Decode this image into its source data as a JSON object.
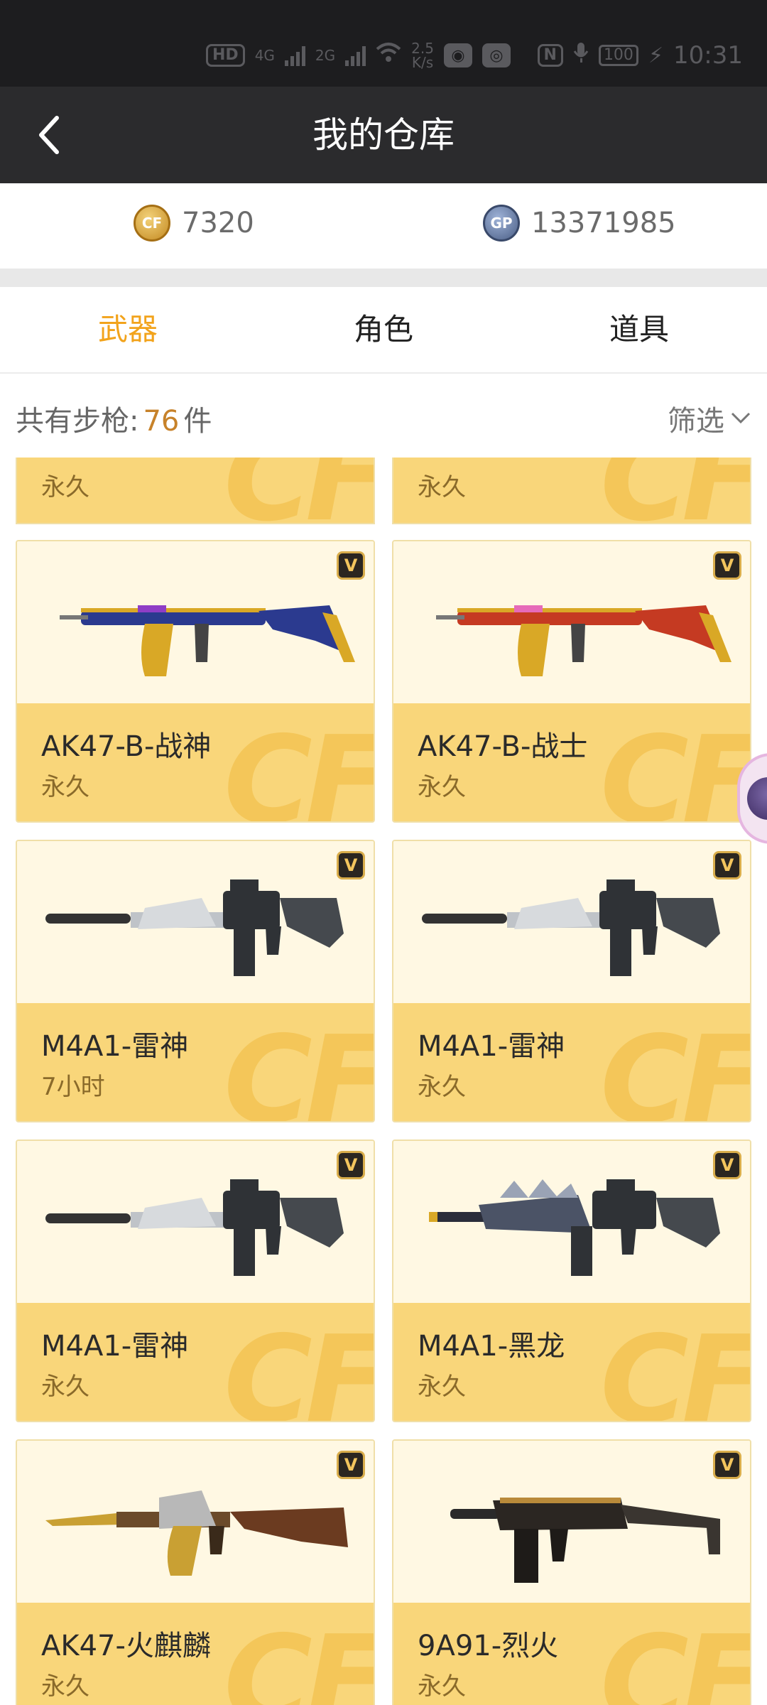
{
  "status_bar": {
    "hd_label": "HD",
    "net1": "4G",
    "net2": "2G",
    "speed_value": "2.5",
    "speed_unit": "K/s",
    "battery": "100",
    "time": "10:31"
  },
  "header": {
    "title": "我的仓库"
  },
  "currency": {
    "cf_coin_icon": "cf-coin-icon",
    "cf_amount": "7320",
    "gp_coin_icon": "gp-coin-icon",
    "gp_label": "GP",
    "gp_amount": "13371985"
  },
  "tabs": [
    {
      "label": "武器",
      "active": true
    },
    {
      "label": "角色",
      "active": false
    },
    {
      "label": "道具",
      "active": false
    }
  ],
  "inventory": {
    "prefix": "共有步枪:",
    "count": "76",
    "suffix": "件",
    "filter_label": "筛选"
  },
  "partial_row": [
    {
      "duration": "永久"
    },
    {
      "duration": "永久"
    }
  ],
  "items": [
    {
      "name": "AK47-B-战神",
      "duration": "永久",
      "badge": "V",
      "gun": "ak-blue"
    },
    {
      "name": "AK47-B-战士",
      "duration": "永久",
      "badge": "V",
      "gun": "ak-red"
    },
    {
      "name": "M4A1-雷神",
      "duration": "7小时",
      "badge": "V",
      "gun": "m4-silver"
    },
    {
      "name": "M4A1-雷神",
      "duration": "永久",
      "badge": "V",
      "gun": "m4-silver"
    },
    {
      "name": "M4A1-雷神",
      "duration": "永久",
      "badge": "V",
      "gun": "m4-silver"
    },
    {
      "name": "M4A1-黑龙",
      "duration": "永久",
      "badge": "V",
      "gun": "m4-dragon"
    },
    {
      "name": "AK47-火麒麟",
      "duration": "永久",
      "badge": "V",
      "gun": "ak-gold"
    },
    {
      "name": "9A91-烈火",
      "duration": "永久",
      "badge": "V",
      "gun": "smg-black"
    }
  ]
}
